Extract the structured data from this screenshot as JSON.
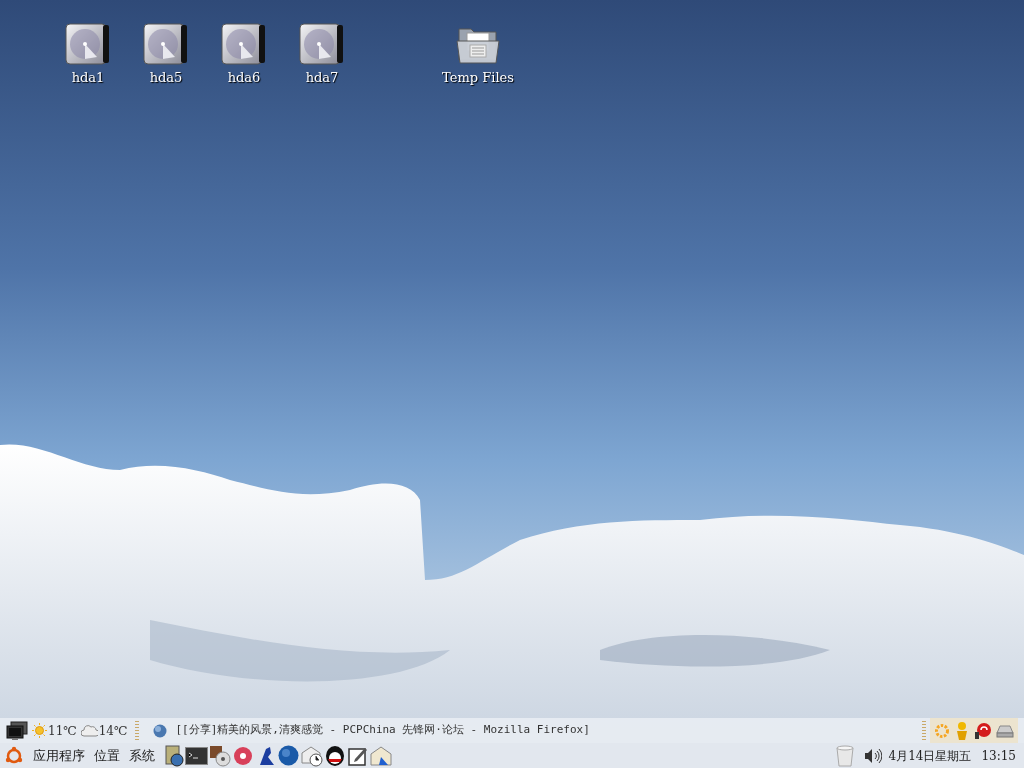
{
  "desktop": {
    "icons": [
      {
        "label": "hda1",
        "kind": "drive"
      },
      {
        "label": "hda5",
        "kind": "drive"
      },
      {
        "label": "hda6",
        "kind": "drive"
      },
      {
        "label": "hda7",
        "kind": "drive"
      },
      {
        "label": "Temp Files",
        "kind": "folder"
      }
    ]
  },
  "top_panel": {
    "weather": [
      {
        "kind": "sunny",
        "temperature": "11℃"
      },
      {
        "kind": "cloudy",
        "temperature": "14℃"
      }
    ],
    "window_list": [
      {
        "title": "[[分享]精美的风景,清爽感觉 - PCPChina 先锋网·论坛 - Mozilla Firefox]",
        "selected": false
      }
    ]
  },
  "bottom_panel": {
    "menus": [
      "应用程序",
      "位置",
      "系统"
    ],
    "clock": {
      "date": "4月14日星期五",
      "time": "13:15"
    }
  }
}
